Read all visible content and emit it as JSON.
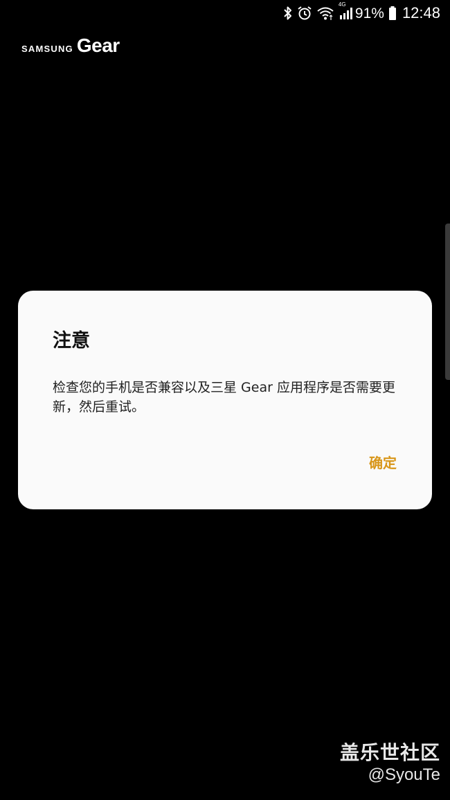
{
  "status_bar": {
    "icons": [
      "bluetooth-icon",
      "alarm-icon",
      "wifi-icon",
      "signal-4g-icon",
      "battery-icon"
    ],
    "network_label": "4G",
    "battery_percent": "91%",
    "time": "12:48"
  },
  "logo": {
    "brand": "SAMSUNG",
    "product": "Gear"
  },
  "dialog": {
    "title": "注意",
    "message": "检查您的手机是否兼容以及三星 Gear 应用程序是否需要更新，然后重试。",
    "confirm_label": "确定",
    "accent_color": "#d89619"
  },
  "watermark": {
    "line1": "盖乐世社区",
    "line2": "@SyouTe"
  }
}
